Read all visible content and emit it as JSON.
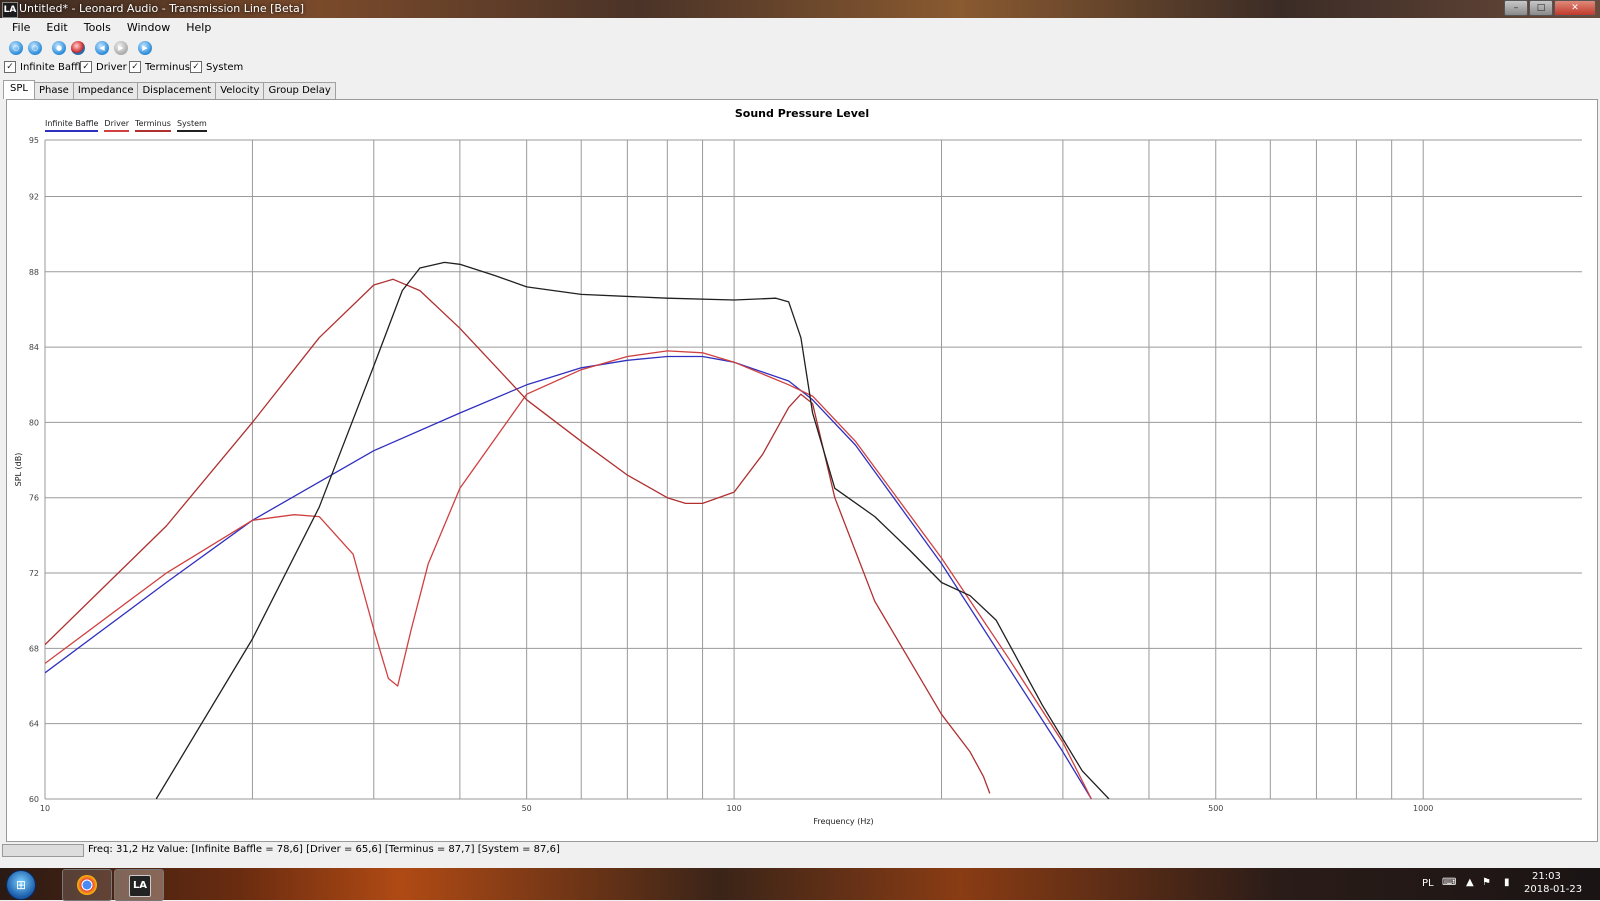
{
  "window": {
    "app_icon_text": "LA",
    "title": "Untitled* - Leonard Audio - Transmission Line [Beta]",
    "buttons": [
      "minimize",
      "maximize",
      "close"
    ]
  },
  "menu": [
    "File",
    "Edit",
    "Tools",
    "Window",
    "Help"
  ],
  "toolbar": {
    "icons": [
      "new-icon",
      "open-icon",
      "play-icon",
      "record-icon",
      "back-icon",
      "forward-icon",
      "run-icon"
    ]
  },
  "checkboxes": [
    {
      "label": "Infinite Baffle",
      "checked": true
    },
    {
      "label": "Driver",
      "checked": true
    },
    {
      "label": "Terminus",
      "checked": true
    },
    {
      "label": "System",
      "checked": true
    }
  ],
  "tabs": [
    {
      "label": "SPL",
      "active": true
    },
    {
      "label": "Phase",
      "active": false
    },
    {
      "label": "Impedance",
      "active": false
    },
    {
      "label": "Displacement",
      "active": false
    },
    {
      "label": "Velocity",
      "active": false
    },
    {
      "label": "Group Delay",
      "active": false
    }
  ],
  "chart_data": {
    "type": "line",
    "title": "Sound Pressure Level",
    "xlabel": "Frequency (Hz)",
    "ylabel": "SPL (dB)",
    "x_scale": "log",
    "xlim": [
      10,
      1700
    ],
    "ylim": [
      60,
      95
    ],
    "x_tick_labels": [
      {
        "value": 10,
        "label": "10"
      },
      {
        "value": 50,
        "label": "50"
      },
      {
        "value": 100,
        "label": "100"
      },
      {
        "value": 500,
        "label": "500"
      },
      {
        "value": 1000,
        "label": "1000"
      }
    ],
    "x_gridlines": [
      20,
      30,
      40,
      50,
      60,
      70,
      80,
      90,
      100,
      200,
      300,
      400,
      500,
      600,
      700,
      800,
      900,
      1000,
      2000
    ],
    "y_ticks": [
      95,
      92,
      88,
      84,
      80,
      76,
      72,
      68,
      64,
      60
    ],
    "grid": true,
    "legend_position": "top-left",
    "series": [
      {
        "name": "Infinite Baffle",
        "color": "#3030c0",
        "points": [
          [
            10,
            66.7
          ],
          [
            15,
            71.5
          ],
          [
            20,
            74.8
          ],
          [
            30,
            78.5
          ],
          [
            40,
            80.5
          ],
          [
            50,
            82
          ],
          [
            60,
            82.9
          ],
          [
            70,
            83.3
          ],
          [
            80,
            83.5
          ],
          [
            90,
            83.5
          ],
          [
            100,
            83.2
          ],
          [
            120,
            82.2
          ],
          [
            130,
            81.2
          ],
          [
            150,
            78.8
          ],
          [
            200,
            72.5
          ],
          [
            250,
            67
          ],
          [
            300,
            62.5
          ],
          [
            330,
            60
          ]
        ]
      },
      {
        "name": "Driver",
        "color": "#d04040",
        "points": [
          [
            10,
            67.2
          ],
          [
            15,
            72
          ],
          [
            20,
            74.8
          ],
          [
            23,
            75.1
          ],
          [
            25,
            75
          ],
          [
            28,
            73
          ],
          [
            30,
            69
          ],
          [
            31.5,
            66.4
          ],
          [
            32.5,
            66
          ],
          [
            34,
            69
          ],
          [
            36,
            72.5
          ],
          [
            40,
            76.5
          ],
          [
            50,
            81.5
          ],
          [
            60,
            82.8
          ],
          [
            70,
            83.5
          ],
          [
            80,
            83.8
          ],
          [
            90,
            83.7
          ],
          [
            100,
            83.2
          ],
          [
            120,
            82
          ],
          [
            130,
            81.4
          ],
          [
            150,
            79
          ],
          [
            200,
            72.8
          ],
          [
            250,
            67.5
          ],
          [
            300,
            63
          ],
          [
            330,
            60
          ]
        ]
      },
      {
        "name": "Terminus",
        "color": "#b03030",
        "points": [
          [
            10,
            68.2
          ],
          [
            15,
            74.5
          ],
          [
            20,
            80
          ],
          [
            25,
            84.5
          ],
          [
            30,
            87.3
          ],
          [
            32,
            87.6
          ],
          [
            35,
            87
          ],
          [
            40,
            85
          ],
          [
            45,
            83
          ],
          [
            50,
            81.2
          ],
          [
            60,
            79
          ],
          [
            70,
            77.2
          ],
          [
            80,
            76
          ],
          [
            85,
            75.7
          ],
          [
            90,
            75.7
          ],
          [
            100,
            76.3
          ],
          [
            110,
            78.3
          ],
          [
            120,
            80.8
          ],
          [
            125,
            81.5
          ],
          [
            130,
            81
          ],
          [
            140,
            76
          ],
          [
            160,
            70.5
          ],
          [
            200,
            64.5
          ],
          [
            220,
            62.5
          ],
          [
            230,
            61.2
          ],
          [
            235,
            60.3
          ]
        ]
      },
      {
        "name": "System",
        "color": "#202020",
        "points": [
          [
            14.5,
            60
          ],
          [
            20,
            68.5
          ],
          [
            25,
            75.5
          ],
          [
            30,
            83
          ],
          [
            33,
            87
          ],
          [
            35,
            88.2
          ],
          [
            38,
            88.5
          ],
          [
            40,
            88.4
          ],
          [
            45,
            87.8
          ],
          [
            50,
            87.2
          ],
          [
            60,
            86.8
          ],
          [
            80,
            86.6
          ],
          [
            100,
            86.5
          ],
          [
            115,
            86.6
          ],
          [
            120,
            86.4
          ],
          [
            125,
            84.5
          ],
          [
            130,
            80.5
          ],
          [
            140,
            76.5
          ],
          [
            160,
            75
          ],
          [
            180,
            73.2
          ],
          [
            200,
            71.5
          ],
          [
            220,
            70.8
          ],
          [
            240,
            69.5
          ],
          [
            280,
            65
          ],
          [
            320,
            61.5
          ],
          [
            350,
            60
          ]
        ]
      }
    ]
  },
  "status": {
    "text": "Freq: 31,2 Hz   Value: [Infinite Baffle = 78,6]   [Driver = 65,6]   [Terminus = 87,7]   [System = 87,6]"
  },
  "taskbar": {
    "apps": [
      "chrome-icon",
      "leonard-audio-icon"
    ],
    "lang": "PL",
    "time": "21:03",
    "date": "2018-01-23"
  }
}
